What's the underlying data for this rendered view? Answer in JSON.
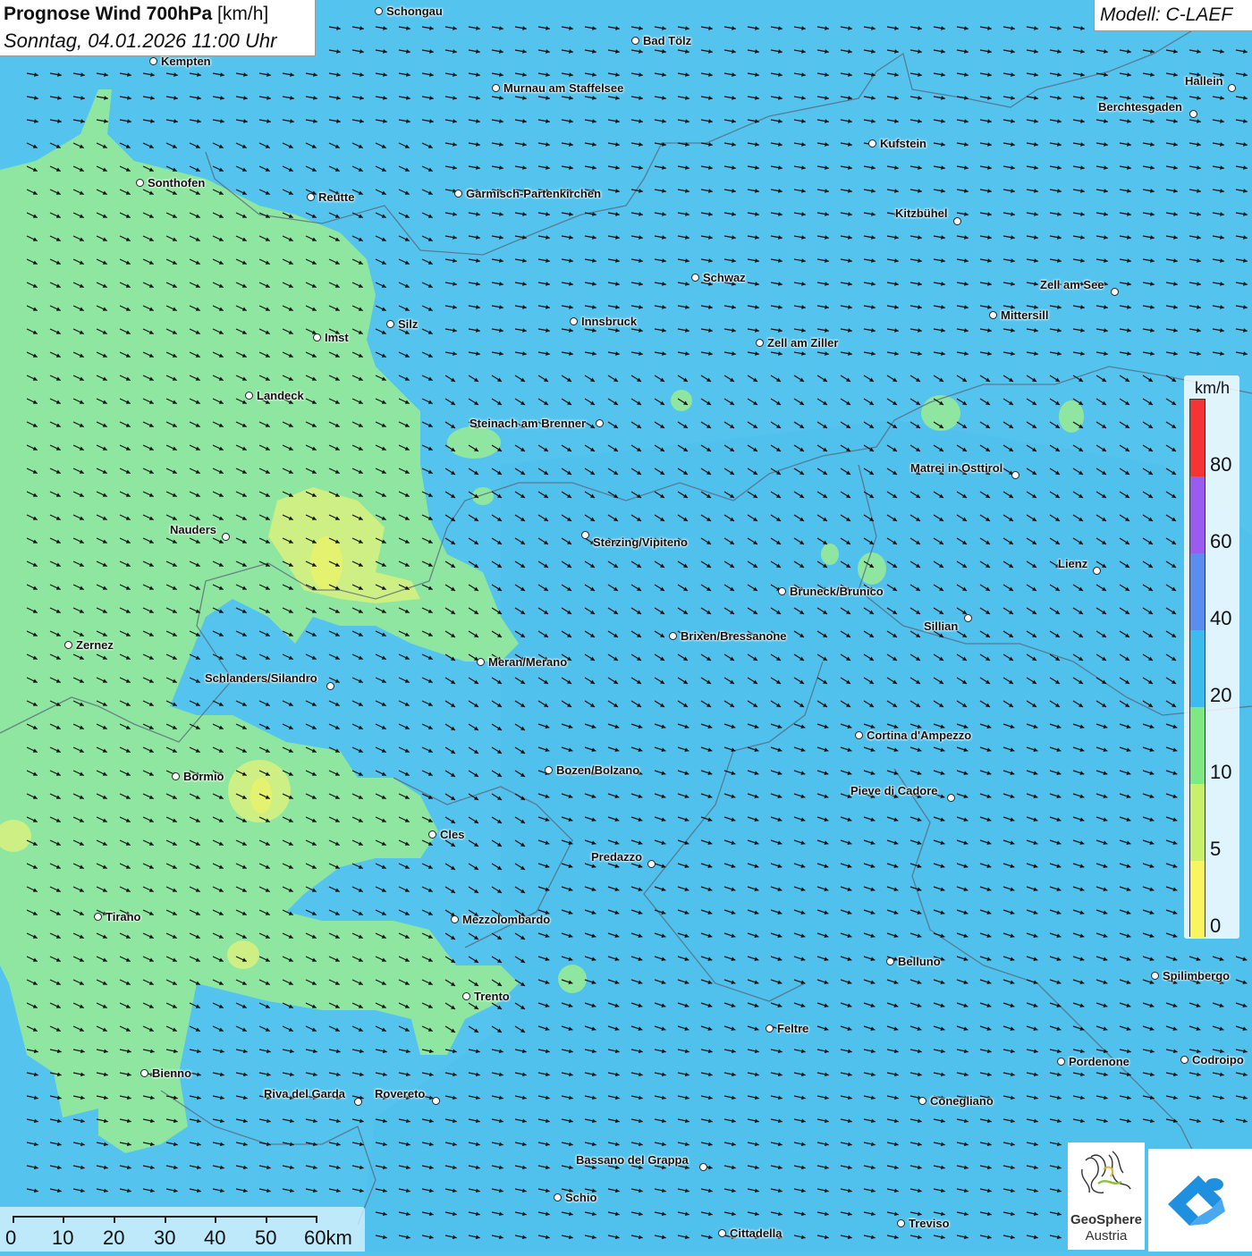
{
  "header": {
    "title": "Prognose Wind 700hPa",
    "unit": "[km/h]",
    "date": "Sonntag, 04.01.2026 11:00 Uhr"
  },
  "model": "Modell: C-LAEF",
  "legend": {
    "unit": "km/h",
    "labels": [
      "80",
      "60",
      "40",
      "20",
      "10",
      "5",
      "0"
    ],
    "colors": [
      "#f53535",
      "#9a5cf0",
      "#5b8cf0",
      "#3bbbee",
      "#7fe883",
      "#c8f06a",
      "#f8f560"
    ]
  },
  "scale": {
    "labels": [
      "0",
      "10",
      "20",
      "30",
      "40",
      "50",
      "60km"
    ]
  },
  "cities": [
    {
      "name": "Schongau"
    },
    {
      "name": "Bad Tölz"
    },
    {
      "name": "Kempten"
    },
    {
      "name": "Murnau am Staffelsee"
    },
    {
      "name": "Hallein"
    },
    {
      "name": "Berchtesgaden"
    },
    {
      "name": "Kufstein"
    },
    {
      "name": "Sonthofen"
    },
    {
      "name": "Reutte"
    },
    {
      "name": "Garmisch-Partenkirchen"
    },
    {
      "name": "Kitzbühel"
    },
    {
      "name": "Schwaz"
    },
    {
      "name": "Zell am See"
    },
    {
      "name": "Mittersill"
    },
    {
      "name": "Silz"
    },
    {
      "name": "Innsbruck"
    },
    {
      "name": "Imst"
    },
    {
      "name": "Zell am Ziller"
    },
    {
      "name": "Landeck"
    },
    {
      "name": "Steinach am Brenner"
    },
    {
      "name": "Matrei in Osttirol"
    },
    {
      "name": "Nauders"
    },
    {
      "name": "Sterzing/Vipiteno"
    },
    {
      "name": "Lienz"
    },
    {
      "name": "Bruneck/Brunico"
    },
    {
      "name": "Sillian"
    },
    {
      "name": "Brixen/Bressanone"
    },
    {
      "name": "Zernez"
    },
    {
      "name": "Meran/Merano"
    },
    {
      "name": "Schlanders/Silandro"
    },
    {
      "name": "Cortina d'Ampezzo"
    },
    {
      "name": "Bozen/Bolzano"
    },
    {
      "name": "Bormio"
    },
    {
      "name": "Pieve di Cadore"
    },
    {
      "name": "Cles"
    },
    {
      "name": "Predazzo"
    },
    {
      "name": "Tirano"
    },
    {
      "name": "Mezzolombardo"
    },
    {
      "name": "Belluno"
    },
    {
      "name": "Spilimbergo"
    },
    {
      "name": "Trento"
    },
    {
      "name": "Feltre"
    },
    {
      "name": "Pordenone"
    },
    {
      "name": "Codroipo"
    },
    {
      "name": "Bienno"
    },
    {
      "name": "Riva del Garda"
    },
    {
      "name": "Rovereto"
    },
    {
      "name": "Conegliano"
    },
    {
      "name": "Bassano del Grappa"
    },
    {
      "name": "Schio"
    },
    {
      "name": "Treviso"
    },
    {
      "name": "Cittadella"
    }
  ],
  "logos": {
    "geosphere_line1": "GeoSphere",
    "geosphere_line2": "Austria"
  }
}
